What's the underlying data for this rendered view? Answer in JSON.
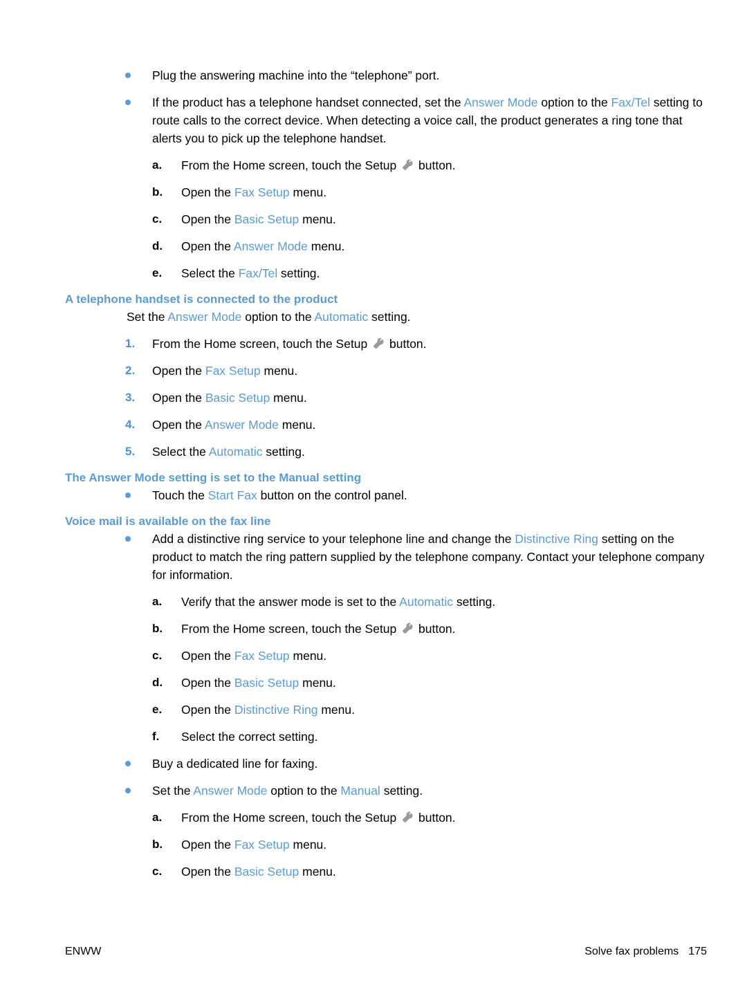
{
  "document": {
    "footer": {
      "left": "ENWW",
      "section": "Solve fax problems",
      "page_number": "175"
    },
    "colors": {
      "ui_term_blue": "#5b9bd5",
      "heading_blue": "#5b9bd5",
      "number_blue": "#4a90d9",
      "bullet_blue": "#5b9bd5",
      "body_text": "#000000",
      "wrench_icon_gray": "#9a9a9a"
    }
  },
  "blocks": {
    "b1": {
      "text_a": "Plug the answering machine into the “telephone” port."
    },
    "b2": {
      "t1": "If the product has a telephone handset connected, set the ",
      "ui1": "Answer Mode",
      "t2": " option to the ",
      "ui2": "Fax/Tel",
      "t3": " setting to route calls to the correct device. When detecting a voice call, the product generates a ring tone that alerts you to pick up the telephone handset."
    },
    "b2_steps": [
      {
        "marker": "a.",
        "t1": "From the Home screen, touch the Setup ",
        "icon": "wrench-icon",
        "t2": " button."
      },
      {
        "marker": "b.",
        "t1": "Open the ",
        "ui1": "Fax Setup",
        "t2": " menu."
      },
      {
        "marker": "c.",
        "t1": "Open the ",
        "ui1": "Basic Setup",
        "t2": " menu."
      },
      {
        "marker": "d.",
        "t1": "Open the ",
        "ui1": "Answer Mode",
        "t2": " menu."
      },
      {
        "marker": "e.",
        "t1": "Select the ",
        "ui1": "Fax/Tel",
        "t2": " setting."
      }
    ],
    "h1": "A telephone handset is connected to the product",
    "h1_intro": {
      "t1": "Set the ",
      "ui1": "Answer Mode",
      "t2": " option to the ",
      "ui2": "Automatic",
      "t3": " setting."
    },
    "h1_steps": [
      {
        "marker": "1.",
        "t1": "From the Home screen, touch the Setup ",
        "icon": "wrench-icon",
        "t2": " button."
      },
      {
        "marker": "2.",
        "t1": "Open the ",
        "ui1": "Fax Setup",
        "t2": " menu."
      },
      {
        "marker": "3.",
        "t1": "Open the ",
        "ui1": "Basic Setup",
        "t2": " menu."
      },
      {
        "marker": "4.",
        "t1": "Open the ",
        "ui1": "Answer Mode",
        "t2": " menu."
      },
      {
        "marker": "5.",
        "t1": "Select the ",
        "ui1": "Automatic",
        "t2": " setting."
      }
    ],
    "h2": "The Answer Mode setting is set to the Manual setting",
    "h2_bullet": {
      "t1": "Touch the ",
      "ui1": "Start Fax",
      "t2": " button on the control panel."
    },
    "h3": "Voice mail is available on the fax line",
    "h3_bullet1": {
      "t1": "Add a distinctive ring service to your telephone line and change the ",
      "ui1": "Distinctive Ring",
      "t2": " setting on the product to match the ring pattern supplied by the telephone company. Contact your telephone company for information."
    },
    "h3_steps": [
      {
        "marker": "a.",
        "t1": "Verify that the answer mode is set to the ",
        "ui1": "Automatic",
        "t2": " setting."
      },
      {
        "marker": "b.",
        "t1": "From the Home screen, touch the Setup ",
        "icon": "wrench-icon",
        "t2": " button."
      },
      {
        "marker": "c.",
        "t1": "Open the ",
        "ui1": "Fax Setup",
        "t2": " menu."
      },
      {
        "marker": "d.",
        "t1": "Open the ",
        "ui1": "Basic Setup",
        "t2": " menu."
      },
      {
        "marker": "e.",
        "t1": "Open the ",
        "ui1": "Distinctive Ring",
        "t2": " menu."
      },
      {
        "marker": "f.",
        "t1": "Select the correct setting.",
        "ui1": "",
        "t2": ""
      }
    ],
    "h3_bullet2": {
      "t1": "Buy a dedicated line for faxing."
    },
    "h3_bullet3": {
      "t1": "Set the ",
      "ui1": "Answer Mode",
      "t2": " option to the ",
      "ui2": "Manual",
      "t3": " setting."
    },
    "h3_steps2": [
      {
        "marker": "a.",
        "t1": "From the Home screen, touch the Setup ",
        "icon": "wrench-icon",
        "t2": " button."
      },
      {
        "marker": "b.",
        "t1": "Open the ",
        "ui1": "Fax Setup",
        "t2": " menu."
      },
      {
        "marker": "c.",
        "t1": "Open the ",
        "ui1": "Basic Setup",
        "t2": " menu."
      }
    ]
  }
}
